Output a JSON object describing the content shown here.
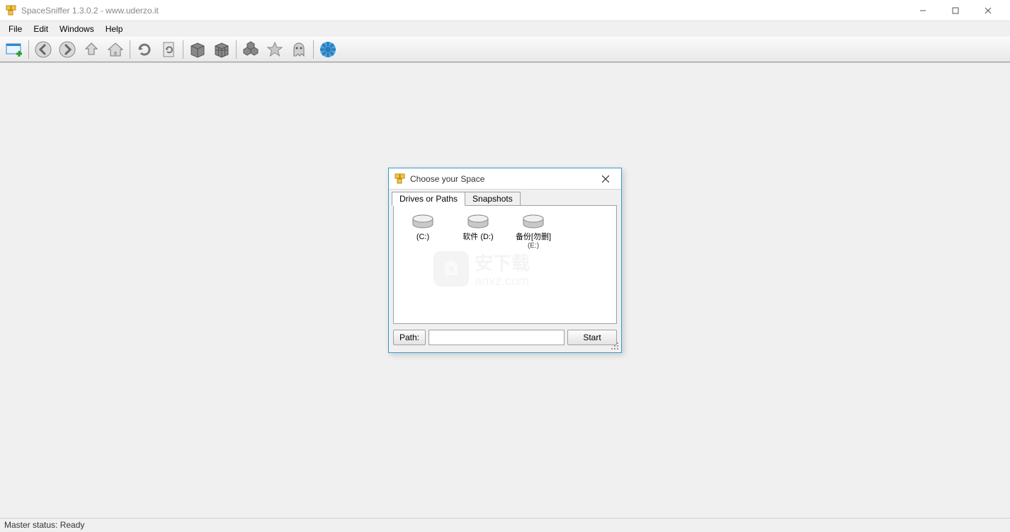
{
  "window": {
    "title": "SpaceSniffer 1.3.0.2 - www.uderzo.it"
  },
  "menu": {
    "file": "File",
    "edit": "Edit",
    "windows": "Windows",
    "help": "Help"
  },
  "toolbar": {
    "new": "new-scan-icon",
    "back": "back-icon",
    "forward": "forward-icon",
    "up": "level-up-icon",
    "home": "home-icon",
    "refresh": "refresh-icon",
    "rescan": "rescan-file-icon",
    "detail_less": "detail-less-icon",
    "detail_more": "detail-more-icon",
    "blocks": "blocks-icon",
    "star": "favorite-icon",
    "ghost": "ghost-icon",
    "gear": "settings-gear-icon"
  },
  "dialog": {
    "title": "Choose your Space",
    "tabs": {
      "drives": "Drives or Paths",
      "snapshots": "Snapshots"
    },
    "drives": [
      {
        "label": "(C:)",
        "sub": ""
      },
      {
        "label": "软件 (D:)",
        "sub": ""
      },
      {
        "label": "备份[勿删]",
        "sub": "(E:)"
      }
    ],
    "path_label": "Path:",
    "path_value": "",
    "start": "Start",
    "watermark": "anxz.com"
  },
  "status": {
    "text": "Master status: Ready"
  }
}
